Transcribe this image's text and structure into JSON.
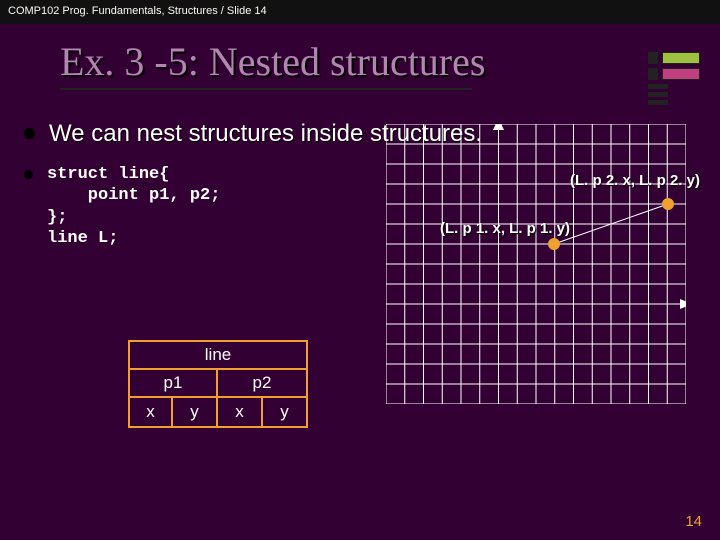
{
  "header": "COMP102 Prog. Fundamentals, Structures / Slide 14",
  "title": "Ex. 3 -5: Nested structures",
  "bullet1": "We can nest structures inside structures.",
  "code": "struct line{\n    point p1, p2;\n};\nline L;",
  "graph": {
    "label_p1": "(L. p 1. x, L. p 1. y)",
    "label_p2": "(L. p 2. x, L. p 2. y)"
  },
  "table": {
    "line": "line",
    "p1": "p1",
    "p2": "p2",
    "x1": "x",
    "y1": "y",
    "x2": "x",
    "y2": "y"
  },
  "page_number": "14",
  "chart_data": {
    "type": "scatter",
    "title": "Line with two endpoints p1 and p2",
    "xlabel": "",
    "ylabel": "",
    "xlim": [
      -6,
      10
    ],
    "ylim": [
      -5,
      9
    ],
    "series": [
      {
        "name": "L",
        "points": [
          {
            "label": "L.p1",
            "x": 3,
            "y": 3
          },
          {
            "label": "L.p2",
            "x": 9,
            "y": 5
          }
        ],
        "connected": true
      }
    ]
  }
}
